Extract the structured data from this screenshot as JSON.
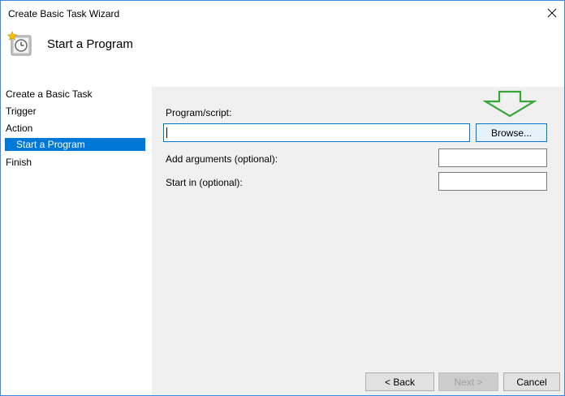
{
  "window": {
    "title": "Create Basic Task Wizard",
    "close_glyph": "✕"
  },
  "header": {
    "title": "Start a Program",
    "icon": "task-scheduler-icon"
  },
  "nav": {
    "items": [
      {
        "label": "Create a Basic Task",
        "selected": false
      },
      {
        "label": "Trigger",
        "selected": false
      },
      {
        "label": "Action",
        "selected": false
      },
      {
        "label": "Start a Program",
        "selected": true
      },
      {
        "label": "Finish",
        "selected": false
      }
    ]
  },
  "form": {
    "program_label": "Program/script:",
    "program_value": "",
    "browse_label": "Browse...",
    "arguments_label": "Add arguments (optional):",
    "arguments_value": "",
    "startin_label": "Start in (optional):",
    "startin_value": ""
  },
  "footer": {
    "back_label": "< Back",
    "next_label": "Next >",
    "cancel_label": "Cancel"
  },
  "colors": {
    "accent": "#0078d7",
    "arrow": "#3aa63a"
  }
}
